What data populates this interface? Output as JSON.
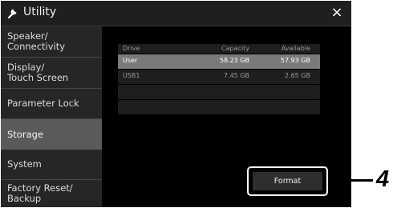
{
  "window": {
    "title": "Utility",
    "close_symbol": "×"
  },
  "sidebar": {
    "items": [
      {
        "line1": "Speaker/",
        "line2": "Connectivity"
      },
      {
        "line1": "Display/",
        "line2": "Touch Screen"
      },
      {
        "line1": "Parameter Lock",
        "line2": ""
      },
      {
        "line1": "Storage",
        "line2": ""
      },
      {
        "line1": "System",
        "line2": ""
      },
      {
        "line1": "Factory Reset/",
        "line2": "Backup"
      }
    ],
    "active": "Storage"
  },
  "drive_table": {
    "headers": {
      "drive": "Drive",
      "capacity": "Capacity",
      "available": "Available"
    },
    "rows": [
      {
        "drive": "User",
        "capacity": "58.23 GB",
        "available": "57.93 GB",
        "selected": true
      },
      {
        "drive": "USB1",
        "capacity": "7.45 GB",
        "available": "2.65 GB",
        "selected": false
      }
    ]
  },
  "actions": {
    "format_label": "Format"
  },
  "callout": {
    "number": "4"
  }
}
